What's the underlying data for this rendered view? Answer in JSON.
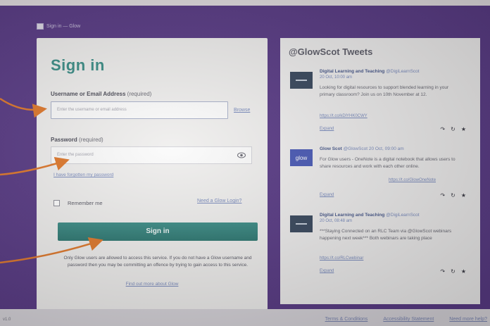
{
  "header": {
    "logo_text": "Sign in — Glow"
  },
  "signin": {
    "title": "Sign in",
    "username_label": "Username or Email Address",
    "username_required": "(required)",
    "username_placeholder": "Enter the username or email address",
    "browse_label": "Browse",
    "password_label": "Password",
    "password_required": "(required)",
    "password_placeholder": "Enter the password",
    "forgot_label": "I have forgotten my password",
    "remember_label": "Remember me",
    "need_label": "Need a Glow Login?",
    "button_label": "Sign in",
    "notice": "Only Glow users are allowed to access this service. If you do not have a Glow username and password then you may be committing an offence by trying to gain access to this service.",
    "find_label": "Find out more about Glow"
  },
  "tweets": {
    "title": "@GlowScot Tweets",
    "items": [
      {
        "name": "Digital Learning and Teaching",
        "handle": "@DigiLearnScot",
        "time": "20 Oct, 10:00 am",
        "text": "Looking for digital resources to support blended learning in your primary classroom? Join us on 10th November at 12.",
        "link": "https://t.co/kDlYHK0CWY",
        "expand": "Expand",
        "avatar_color": "#3b4a5f"
      },
      {
        "name": "Glow Scot",
        "handle": "@GlowScot",
        "time": "20 Oct, 09:00 am",
        "text": "For Glow users - OneNote is a digital notebook that allows users to share resources and work with each other online.",
        "link": "https://t.co/GlowOneNote",
        "expand": "Expand",
        "avatar_color": "#4b5bb6",
        "avatar_text": "glow"
      },
      {
        "name": "Digital Learning and Teaching",
        "handle": "@DigiLearnScot",
        "time": "20 Oct, 08:48 am",
        "text": "***Staying Connected on an RLC Team via @GlowScot webinars happening next week*** Both webinars are taking place",
        "link": "https://t.co/RLCwebinar",
        "expand": "Expand",
        "avatar_color": "#3b4a5f"
      }
    ]
  },
  "footer": {
    "links": [
      "Terms & Conditions",
      "Accessibility Statement",
      "Need more help?"
    ],
    "left_text": "v1.0"
  },
  "colors": {
    "background": "#5a3c86",
    "accent": "#3d8f88",
    "arrow": "#e07a2e"
  }
}
